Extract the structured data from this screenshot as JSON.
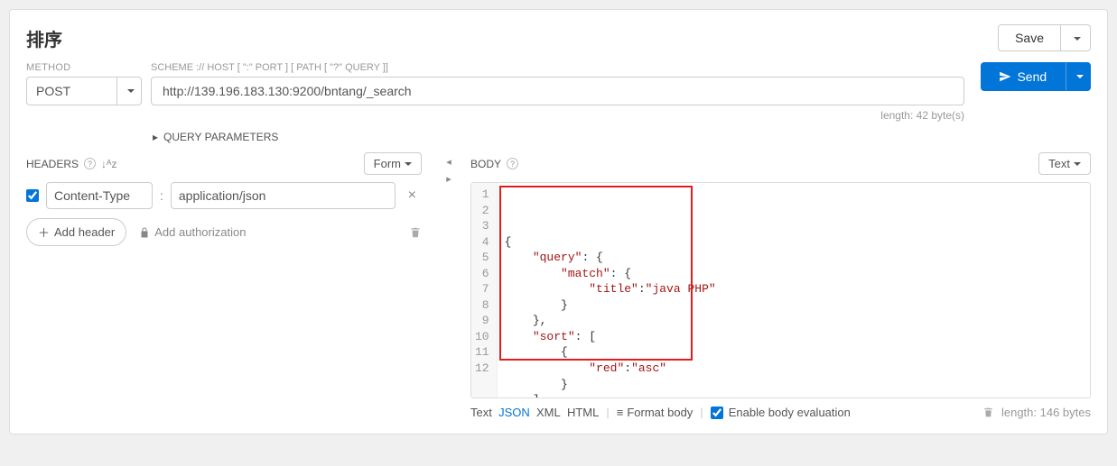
{
  "title": "排序",
  "save": {
    "label": "Save"
  },
  "method": {
    "label": "METHOD",
    "value": "POST"
  },
  "url": {
    "label": "SCHEME :// HOST [ \":\" PORT ] [ PATH [ \"?\" QUERY ]]",
    "value": "http://139.196.183.130:9200/bntang/_search",
    "length_text": "length: 42 byte(s)"
  },
  "send": {
    "label": "Send"
  },
  "query_params": {
    "label": "QUERY PARAMETERS"
  },
  "headers": {
    "title": "HEADERS",
    "form_toggle": "Form",
    "row": {
      "checked": true,
      "name": "Content-Type",
      "value": "application/json"
    },
    "add_header": "Add header",
    "add_auth": "Add authorization"
  },
  "body": {
    "title": "BODY",
    "text_toggle": "Text",
    "lines": [
      "1",
      "2",
      "3",
      "4",
      "5",
      "6",
      "7",
      "8",
      "9",
      "10",
      "11",
      "12"
    ],
    "code": [
      {
        "indent": 0,
        "tokens": [
          [
            "punc",
            "{"
          ]
        ]
      },
      {
        "indent": 1,
        "tokens": [
          [
            "key",
            "\"query\""
          ],
          [
            "punc",
            ": {"
          ]
        ]
      },
      {
        "indent": 2,
        "tokens": [
          [
            "key",
            "\"match\""
          ],
          [
            "punc",
            ": {"
          ]
        ]
      },
      {
        "indent": 3,
        "tokens": [
          [
            "key",
            "\"title\""
          ],
          [
            "punc",
            ":"
          ],
          [
            "str",
            "\"java PHP\""
          ]
        ]
      },
      {
        "indent": 2,
        "tokens": [
          [
            "punc",
            "}"
          ]
        ]
      },
      {
        "indent": 1,
        "tokens": [
          [
            "punc",
            "},"
          ]
        ]
      },
      {
        "indent": 1,
        "tokens": [
          [
            "key",
            "\"sort\""
          ],
          [
            "punc",
            ": ["
          ]
        ]
      },
      {
        "indent": 2,
        "tokens": [
          [
            "punc",
            "{"
          ]
        ]
      },
      {
        "indent": 3,
        "tokens": [
          [
            "key",
            "\"red\""
          ],
          [
            "punc",
            ":"
          ],
          [
            "str",
            "\"asc\""
          ]
        ]
      },
      {
        "indent": 2,
        "tokens": [
          [
            "punc",
            "}"
          ]
        ]
      },
      {
        "indent": 1,
        "tokens": [
          [
            "punc",
            "]"
          ]
        ]
      },
      {
        "indent": 0,
        "tokens": [
          [
            "punc",
            "}"
          ]
        ]
      }
    ],
    "footer": {
      "tabs": [
        "Text",
        "JSON",
        "XML",
        "HTML"
      ],
      "active_tab": "JSON",
      "format_body": "Format body",
      "enable_eval": "Enable body evaluation",
      "enable_eval_checked": true,
      "length_text": "length: 146 bytes"
    }
  }
}
